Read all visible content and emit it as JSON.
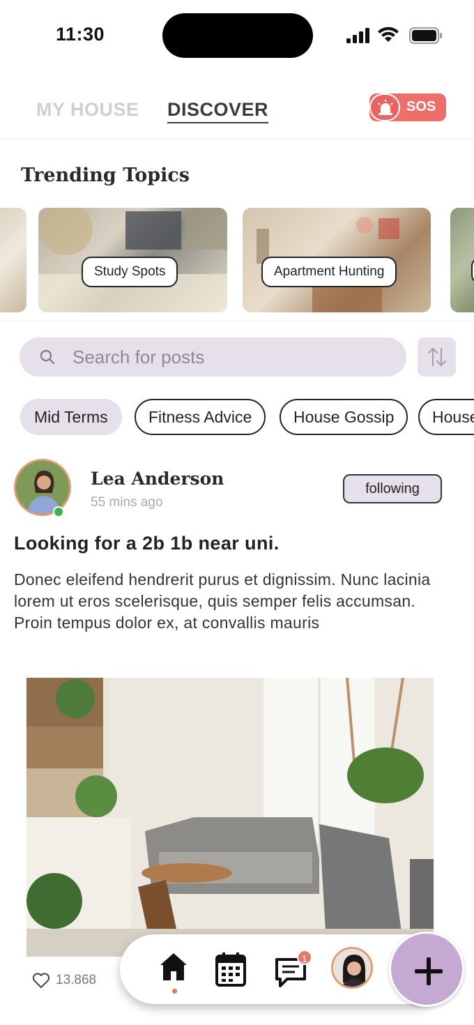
{
  "status_bar": {
    "time": "11:30"
  },
  "header": {
    "tabs": [
      {
        "label": "MY HOUSE"
      },
      {
        "label": "DISCOVER"
      }
    ],
    "sos_label": "SOS"
  },
  "trending": {
    "title": "Trending Topics",
    "cards": [
      {
        "label": "Study Spots"
      },
      {
        "label": "Apartment Hunting"
      }
    ]
  },
  "search": {
    "placeholder": "Search for posts"
  },
  "chips": [
    "Mid Terms",
    "Fitness Advice",
    "House Gossip",
    "House"
  ],
  "post": {
    "author": "Lea Anderson",
    "time_ago": "55 mins ago",
    "follow_label": "following",
    "title": "Looking for a 2b 1b near uni.",
    "body": "Donec eleifend hendrerit purus et dignissim. Nunc lacinia lorem ut eros scelerisque, quis semper felis accumsan. Proin tempus dolor ex, at convallis mauris",
    "likes": "13.868"
  },
  "bottom_nav": {
    "message_badge": "1"
  },
  "colors": {
    "accent": "#e6e0ea",
    "sos": "#ee6e6a",
    "fab": "#c6a9d3",
    "online": "#3fb24a"
  }
}
